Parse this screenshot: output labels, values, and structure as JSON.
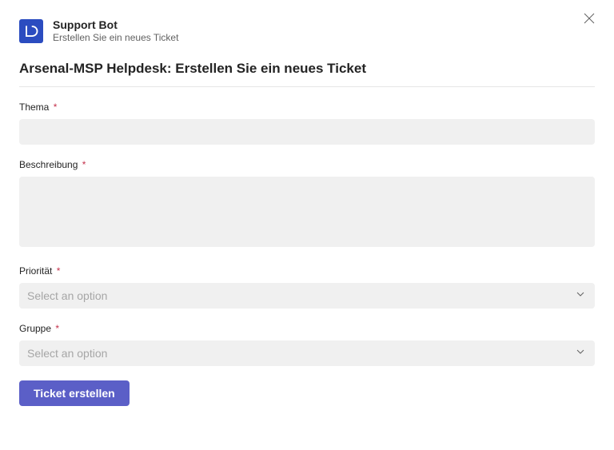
{
  "header": {
    "appName": "Support Bot",
    "subtitle": "Erstellen Sie ein neues Ticket"
  },
  "form": {
    "title": "Arsenal-MSP Helpdesk: Erstellen Sie ein neues Ticket",
    "fields": {
      "subject": {
        "label": "Thema",
        "required": "*",
        "value": ""
      },
      "description": {
        "label": "Beschreibung",
        "required": "*",
        "value": ""
      },
      "priority": {
        "label": "Priorität",
        "required": "*",
        "placeholder": "Select an option"
      },
      "group": {
        "label": "Gruppe",
        "required": "*",
        "placeholder": "Select an option"
      }
    },
    "submitLabel": "Ticket erstellen"
  }
}
